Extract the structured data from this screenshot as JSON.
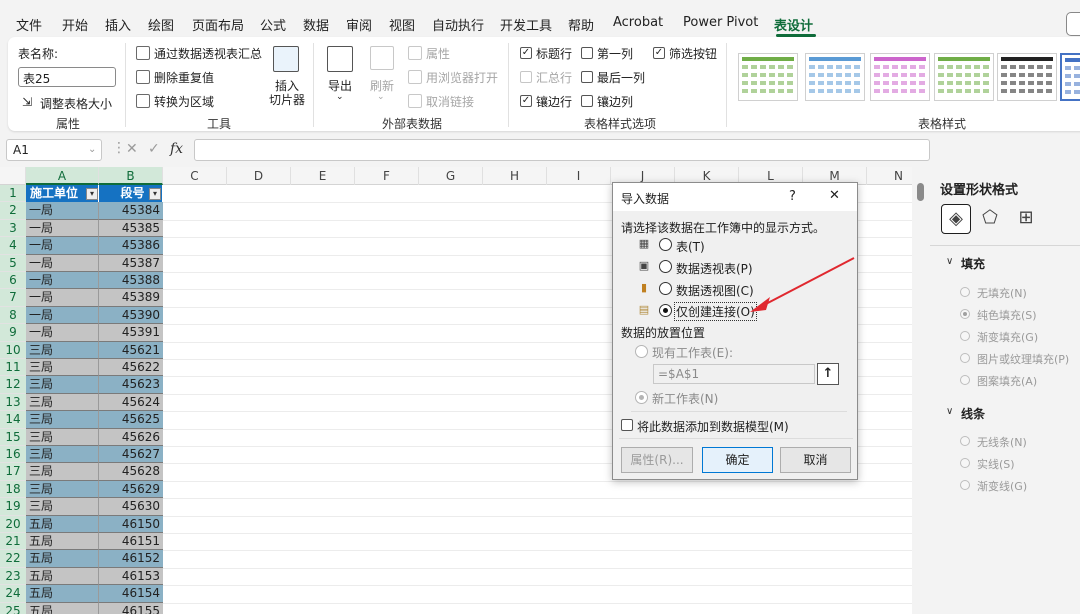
{
  "menu": {
    "tabs": [
      "文件",
      "开始",
      "插入",
      "绘图",
      "页面布局",
      "公式",
      "数据",
      "审阅",
      "视图",
      "自动执行",
      "开发工具",
      "帮助",
      "Acrobat",
      "Power Pivot",
      "表设计"
    ],
    "active": "表设计"
  },
  "ribbon": {
    "properties": {
      "name_label": "表名称:",
      "name_value": "表25",
      "resize_label": "调整表格大小",
      "group_label": "属性"
    },
    "tools": {
      "summarize_pivot": "通过数据透视表汇总",
      "remove_duplicates": "删除重复值",
      "convert_range": "转换为区域",
      "insert_slicer_line1": "插入",
      "insert_slicer_line2": "切片器",
      "group_label": "工具"
    },
    "external": {
      "export": "导出",
      "refresh": "刷新",
      "properties": "属性",
      "open_browser": "用浏览器打开",
      "unlink": "取消链接",
      "group_label": "外部表数据"
    },
    "style_options": {
      "header_row": "标题行",
      "total_row": "汇总行",
      "banded_rows": "镶边行",
      "first_column": "第一列",
      "last_column": "最后一列",
      "banded_columns": "镶边列",
      "filter_button": "筛选按钮",
      "group_label": "表格样式选项"
    },
    "styles": {
      "group_label": "表格样式",
      "swatch_colors": [
        "#70ad47",
        "#5b9bd5",
        "#cc66cc",
        "#70ad47",
        "#222222",
        "#4472c4"
      ]
    }
  },
  "formula_bar": {
    "name_box": "A1",
    "cancel_icon": "✕",
    "confirm_icon": "✓",
    "fx": "fx"
  },
  "sheet": {
    "columns": [
      "A",
      "B",
      "C",
      "D",
      "E",
      "F",
      "G",
      "H",
      "I",
      "J",
      "K",
      "L",
      "M",
      "N"
    ],
    "header": [
      "施工单位",
      "段号"
    ],
    "rows": [
      [
        "一局",
        "45384"
      ],
      [
        "一局",
        "45385"
      ],
      [
        "一局",
        "45386"
      ],
      [
        "一局",
        "45387"
      ],
      [
        "一局",
        "45388"
      ],
      [
        "一局",
        "45389"
      ],
      [
        "一局",
        "45390"
      ],
      [
        "一局",
        "45391"
      ],
      [
        "三局",
        "45621"
      ],
      [
        "三局",
        "45622"
      ],
      [
        "三局",
        "45623"
      ],
      [
        "三局",
        "45624"
      ],
      [
        "三局",
        "45625"
      ],
      [
        "三局",
        "45626"
      ],
      [
        "三局",
        "45627"
      ],
      [
        "三局",
        "45628"
      ],
      [
        "三局",
        "45629"
      ],
      [
        "三局",
        "45630"
      ],
      [
        "五局",
        "46150"
      ],
      [
        "五局",
        "46151"
      ],
      [
        "五局",
        "46152"
      ],
      [
        "五局",
        "46153"
      ],
      [
        "五局",
        "46154"
      ],
      [
        "五局",
        "46155"
      ]
    ],
    "band_colors": [
      "#8bb1c5",
      "#c4c4c4"
    ],
    "header_color": "#1572c2"
  },
  "side_pane": {
    "title": "设置形状格式",
    "fill_section": "填充",
    "fill_options": [
      "无填充(N)",
      "纯色填充(S)",
      "渐变填充(G)",
      "图片或纹理填充(P)",
      "图案填充(A)"
    ],
    "fill_selected_index": 1,
    "line_section": "线条",
    "line_options": [
      "无线条(N)",
      "实线(S)",
      "渐变线(G)"
    ]
  },
  "dialog": {
    "title": "导入数据",
    "help": "?",
    "close": "✕",
    "prompt": "请选择该数据在工作簿中的显示方式。",
    "view_options": [
      "表(T)",
      "数据透视表(P)",
      "数据透视图(C)",
      "仅创建连接(O)"
    ],
    "view_selected_index": 3,
    "placement_label": "数据的放置位置",
    "existing_sheet": "现有工作表(E):",
    "range_value": "=$A$1",
    "new_sheet": "新工作表(N)",
    "add_to_model": "将此数据添加到数据模型(M)",
    "properties_btn": "属性(R)...",
    "ok_btn": "确定",
    "cancel_btn": "取消"
  }
}
